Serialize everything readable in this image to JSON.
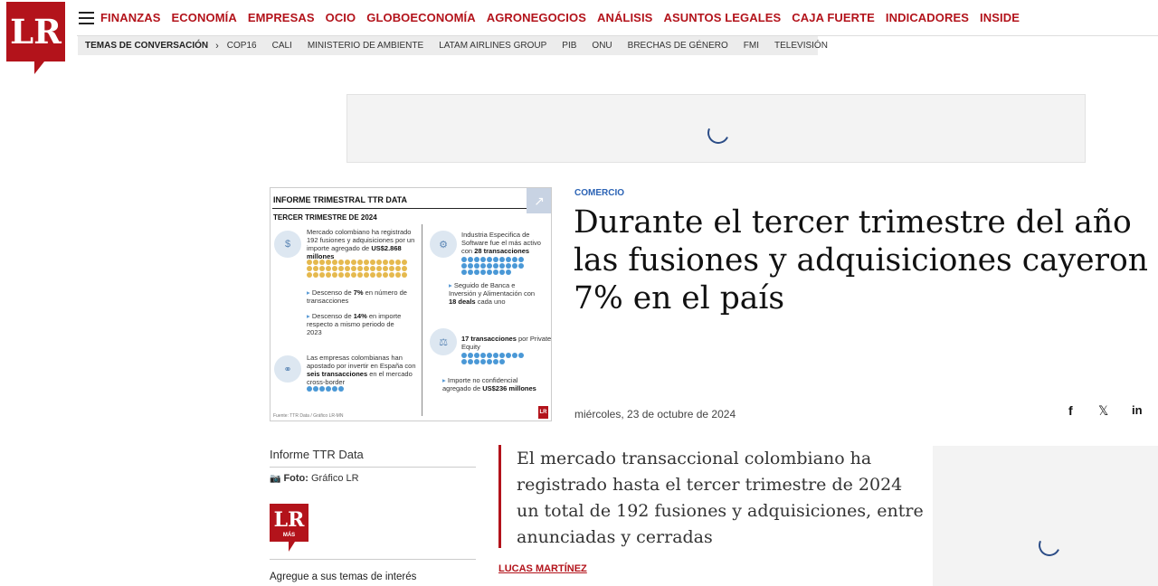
{
  "brand": {
    "logo_text": "LR",
    "logo_color": "#b3131b",
    "mas_logo_text": "LR",
    "mas_logo_sub": "MÁS"
  },
  "nav": {
    "menu_icon": "hamburger-menu-icon",
    "items": [
      "FINANZAS",
      "ECONOMÍA",
      "EMPRESAS",
      "OCIO",
      "GLOBOECONOMÍA",
      "AGRONEGOCIOS",
      "ANÁLISIS",
      "ASUNTOS LEGALES",
      "CAJA FUERTE",
      "INDICADORES",
      "INSIDE"
    ]
  },
  "topics": {
    "label": "TEMAS DE CONVERSACIÓN",
    "chevron": "›",
    "items": [
      "COP16",
      "CALI",
      "MINISTERIO DE AMBIENTE",
      "LATAM AIRLINES GROUP",
      "PIB",
      "ONU",
      "BRECHAS DE GÉNERO",
      "FMI",
      "TELEVISIÓN"
    ]
  },
  "infographic": {
    "title": "INFORME TRIMESTRAL TTR DATA",
    "subtitle": "TERCER TRIMESTRE DE 2024",
    "expand_icon": "↗",
    "block1": {
      "pre": "Mercado colombiano ha registrado 192 fusiones y adquisiciones por un importe agregado de ",
      "bold": "US$2.868 millones"
    },
    "b2": {
      "pre": "Descenso de ",
      "bold": "7%",
      "post": " en número de transacciones"
    },
    "b3": {
      "pre": "Descenso de ",
      "bold": "14%",
      "post": " en importe respecto a mismo periodo de 2023"
    },
    "b4": {
      "pre": "Las empresas colombianas han apostado por invertir en España con ",
      "bold": "seis transacciones",
      "post": " en el mercado cross-border"
    },
    "r1": {
      "pre": "Industria Especifica de Software fue el más activo con ",
      "bold": "28 transacciones"
    },
    "r2": {
      "pre": "Seguido de Banca e Inversión y Alimentación con ",
      "bold": "18 deals",
      "post": " cada uno"
    },
    "r3": {
      "bold": "17 transacciones",
      "post": " por Private Equity"
    },
    "r4": {
      "pre": "Importe no confidencial agregado de ",
      "bold": "US$236 millones"
    },
    "source": "Fuente: TTR Data / Gráfico LR-MN",
    "corner_logo": "LR"
  },
  "article": {
    "section": "COMERCIO",
    "headline_lines": [
      "Durante el tercer trimestre del año",
      "las fusiones y adquisiciones cayeron",
      "7% en el país"
    ],
    "date": "miércoles, 23 de octubre de 2024",
    "share": {
      "facebook": "f",
      "x": "𝕏",
      "linkedin": "in"
    },
    "caption": "Informe TTR Data",
    "credit_label": "Foto:",
    "credit_value": " Gráfico LR",
    "interest": "Agregue a sus temas de interés",
    "lead": "El mercado transaccional colombiano ha registrado hasta el tercer trimestre de 2024 un total de 192 fusiones y adquisiciones, entre anunciadas y cerradas",
    "author": "LUCAS MARTÍNEZ"
  }
}
